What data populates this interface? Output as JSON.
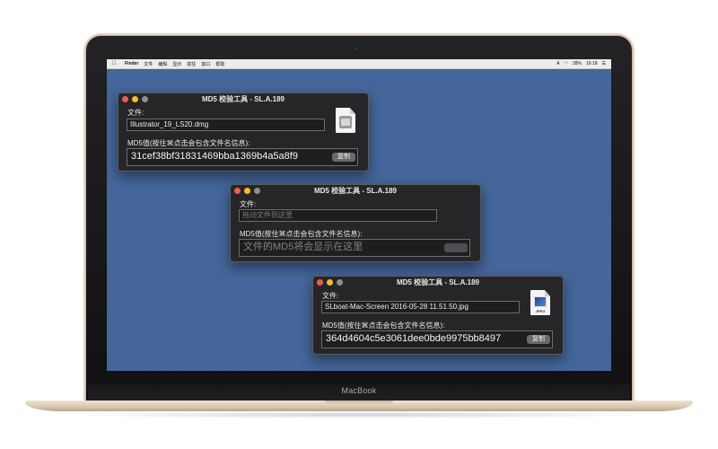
{
  "device": {
    "brand": "MacBook"
  },
  "menubar": {
    "apple_icon": "apple-icon",
    "items": [
      "Finder",
      "文件",
      "编辑",
      "显示",
      "前往",
      "窗口",
      "帮助"
    ],
    "status_items": [
      "A",
      "28%",
      "16:18",
      "☰"
    ]
  },
  "windows": [
    {
      "title": "MD5 校验工具 - SL.A.189",
      "file_label": "文件:",
      "file_value": "Illustrator_19_LS20.dmg",
      "md5_label": "MD5值(按住⌘点击会包含文件名信息):",
      "md5_value": "31cef38bf31831469bba1369b4a5a8f9",
      "copy_label": "复制",
      "icon": "dmg-file-icon"
    },
    {
      "title": "MD5 校验工具 - SL.A.189",
      "file_label": "文件:",
      "file_placeholder": "拖动文件到这里",
      "md5_label": "MD5值(按住⌘点击会包含文件名信息):",
      "md5_placeholder": "文件的MD5将会显示在这里",
      "copy_label": "复制"
    },
    {
      "title": "MD5 校验工具 - SL.A.189",
      "file_label": "文件:",
      "file_value": "SLboat-Mac-Screen 2016-05-28 11.51.50.jpg",
      "md5_label": "MD5值(按住⌘点击会包含文件名信息):",
      "md5_value": "364d4604c5e3061dee0bde9975bb8497",
      "copy_label": "复制",
      "icon": "jpeg-file-icon",
      "icon_ext": "JPEG"
    }
  ],
  "colors": {
    "desktop": "#44669a",
    "window_bg": "#262628",
    "close": "#ee5c54",
    "minimize": "#f3be2f"
  }
}
